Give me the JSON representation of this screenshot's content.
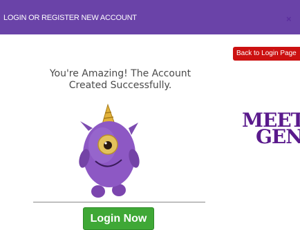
{
  "header": {
    "title": "LOGIN OR REGISTER NEW ACCOUNT",
    "close_label": "×"
  },
  "success": {
    "message": "You're Amazing! The Account Created Successfully.",
    "login_button_label": "Login Now"
  },
  "side": {
    "back_button_label": "Back to Login Page",
    "logo_line1": "MEET",
    "logo_line2": "GEN"
  },
  "icons": {
    "monster": "purple-cyclops-monster-icon",
    "close": "close-icon"
  },
  "colors": {
    "header_bg": "#6a43a8",
    "login_button": "#3fa836",
    "back_button": "#cc1111",
    "logo": "#5a1a8c"
  }
}
